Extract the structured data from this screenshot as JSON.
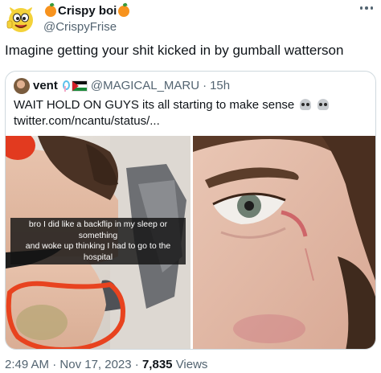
{
  "author": {
    "display_name": "Crispy boi",
    "handle": "@CrispyFrise",
    "avatar_icon": "cartoon-face-avatar"
  },
  "tweet": {
    "text": "Imagine getting your shit kicked in by gumball watterson"
  },
  "quote": {
    "display_name": "vent",
    "handle": "@MAGICAL_MARU",
    "separator": "·",
    "time": "15h",
    "text_line1": "WAIT HOLD ON GUYS its all starting to make sense",
    "text_line2": "twitter.com/ncantu/status/...",
    "photo_caption_line1": "bro I did like a backflip in my sleep or something",
    "photo_caption_line2": "and woke up thinking I had to go to the hospital"
  },
  "footer": {
    "time": "2:49 AM",
    "sep1": "·",
    "date": "Nov 17, 2023",
    "sep2": "·",
    "views_count": "7,835",
    "views_label": "Views"
  },
  "colors": {
    "text": "#0f1419",
    "secondary": "#536471",
    "border": "#cfd9de",
    "orange_emoji": "#f7931e"
  }
}
